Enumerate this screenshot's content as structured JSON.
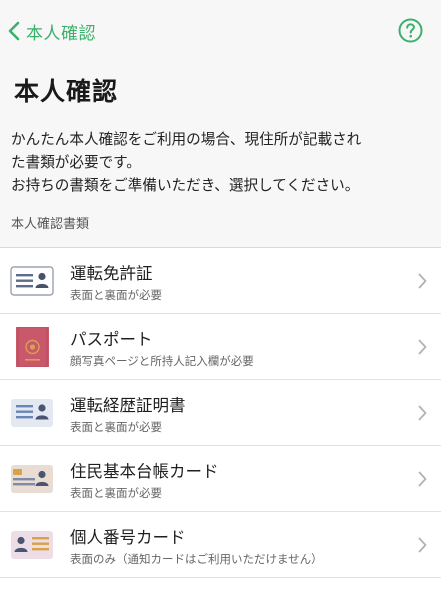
{
  "header": {
    "back_label": "本人確認",
    "help_icon": "question-circle-icon",
    "back_icon": "chevron-left-icon"
  },
  "page": {
    "title": "本人確認",
    "description_lines": [
      "かんたん本人確認をご利用の場合、現住所が記載され",
      "た書類が必要です。",
      "お持ちの書類をご準備いただき、選択してください。"
    ],
    "section_label": "本人確認書類"
  },
  "documents": [
    {
      "label": "運転免許証",
      "sub": "表面と裏面が必要",
      "icon": "license-card-icon"
    },
    {
      "label": "パスポート",
      "sub": "顔写真ページと所持人記入欄が必要",
      "icon": "passport-icon"
    },
    {
      "label": "運転経歴証明書",
      "sub": "表面と裏面が必要",
      "icon": "driving-history-card-icon"
    },
    {
      "label": "住民基本台帳カード",
      "sub": "表面と裏面が必要",
      "icon": "resident-card-icon"
    },
    {
      "label": "個人番号カード",
      "sub": "表面のみ（通知カードはご利用いただけません）",
      "icon": "mynumber-card-icon"
    }
  ],
  "colors": {
    "accent": "#3bb06b",
    "background": "#f7f7f7",
    "passport": "#c8586a"
  }
}
